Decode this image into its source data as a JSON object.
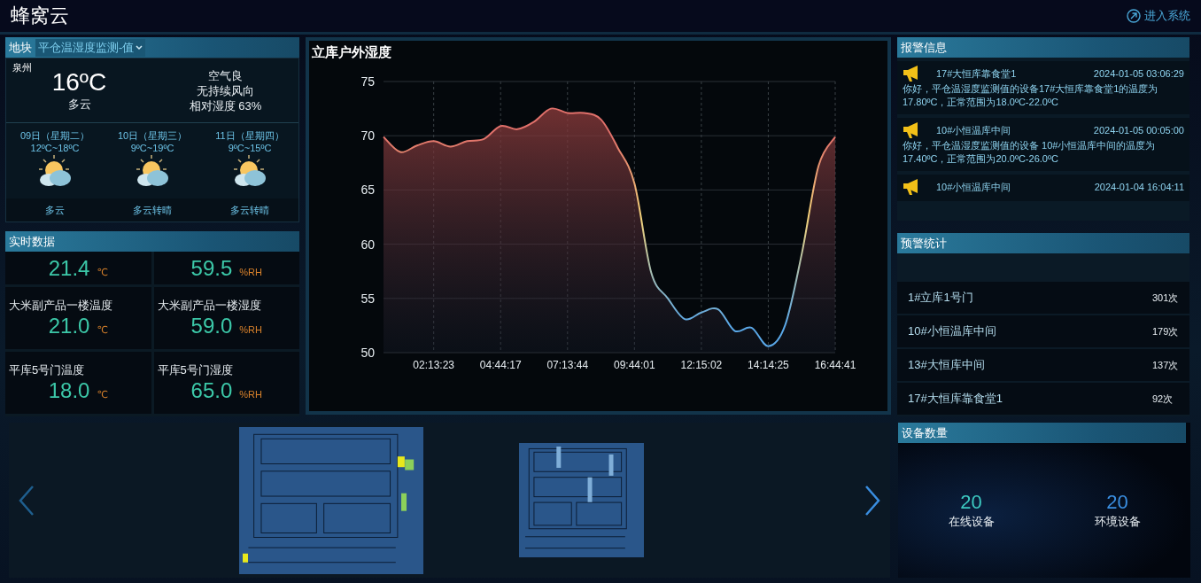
{
  "header": {
    "title": "蜂窝云",
    "enter_link": "进入系统"
  },
  "block_selector": {
    "label": "地块",
    "value": "平仓温湿度监测-值"
  },
  "weather": {
    "city": "泉州",
    "temperature": "16ºC",
    "condition": "多云",
    "air": "空气良",
    "wind": "无持续风向",
    "humidity": "相对湿度 63%",
    "forecast": [
      {
        "date": "09日（星期二）",
        "range": "12ºC~18ºC",
        "condition": "多云"
      },
      {
        "date": "10日（星期三）",
        "range": "9ºC~19ºC",
        "condition": "多云转晴"
      },
      {
        "date": "11日（星期四）",
        "range": "9ºC~15ºC",
        "condition": "多云转晴"
      }
    ]
  },
  "realtime": {
    "title": "实时数据",
    "items": [
      {
        "value": "21.4",
        "unit": "℃"
      },
      {
        "value": "59.5",
        "unit": "%RH"
      },
      {
        "label": "大米副产品一楼温度",
        "value": "21.0",
        "unit": "℃"
      },
      {
        "label": "大米副产品一楼湿度",
        "value": "59.0",
        "unit": "%RH"
      },
      {
        "label": "平库5号门温度",
        "value": "18.0",
        "unit": "℃"
      },
      {
        "label": "平库5号门湿度",
        "value": "65.0",
        "unit": "%RH"
      }
    ]
  },
  "chart": {
    "chart_data": {
      "type": "area",
      "title": "立库户外湿度",
      "categories": [
        null,
        null,
        null,
        "02:13:23",
        null,
        null,
        null,
        "04:44:17",
        null,
        null,
        null,
        "07:13:44",
        null,
        null,
        null,
        "09:44:01",
        null,
        null,
        null,
        "12:15:02",
        null,
        null,
        null,
        "14:14:25",
        null,
        null,
        null,
        "16:44:41"
      ],
      "values": [
        69.9,
        68.5,
        69.1,
        69.5,
        69.0,
        69.5,
        69.7,
        70.9,
        70.6,
        71.3,
        72.5,
        72.1,
        72.1,
        71.5,
        68.9,
        65.6,
        57.4,
        55.0,
        53.1,
        53.7,
        54.0,
        52.0,
        52.3,
        50.6,
        52.5,
        59.1,
        67.2,
        69.9
      ],
      "yticks": [
        50,
        55,
        60,
        65,
        70,
        75
      ],
      "grid": true,
      "ylim": [
        50,
        75
      ]
    }
  },
  "alerts": {
    "title": "报警信息",
    "items": [
      {
        "device": "17#大恒库靠食堂1",
        "time": "2024-01-05 03:06:29",
        "message": "你好，平仓温湿度监测值的设备17#大恒库靠食堂1的温度为17.80ºC，正常范围为18.0ºC-22.0ºC"
      },
      {
        "device": "10#小恒温库中间",
        "time": "2024-01-05 00:05:00",
        "message": "你好，平仓温湿度监测值的设备 10#小恒温库中间的温度为17.40ºC，正常范围为20.0ºC-26.0ºC"
      },
      {
        "device": "10#小恒温库中间",
        "time": "2024-01-04 16:04:11"
      }
    ]
  },
  "warning_stats": {
    "title": "预警统计",
    "rows": [
      {
        "name": "1#立库1号门",
        "count": "301次"
      },
      {
        "name": "10#小恒温库中间",
        "count": "179次"
      },
      {
        "name": "13#大恒库中间",
        "count": "137次"
      },
      {
        "name": "17#大恒库靠食堂1",
        "count": "92次"
      }
    ]
  },
  "devices": {
    "title": "设备数量",
    "stats": [
      {
        "kind": "online",
        "value": "20",
        "label": "在线设备"
      },
      {
        "kind": "environment",
        "value": "20",
        "label": "环境设备"
      }
    ]
  }
}
